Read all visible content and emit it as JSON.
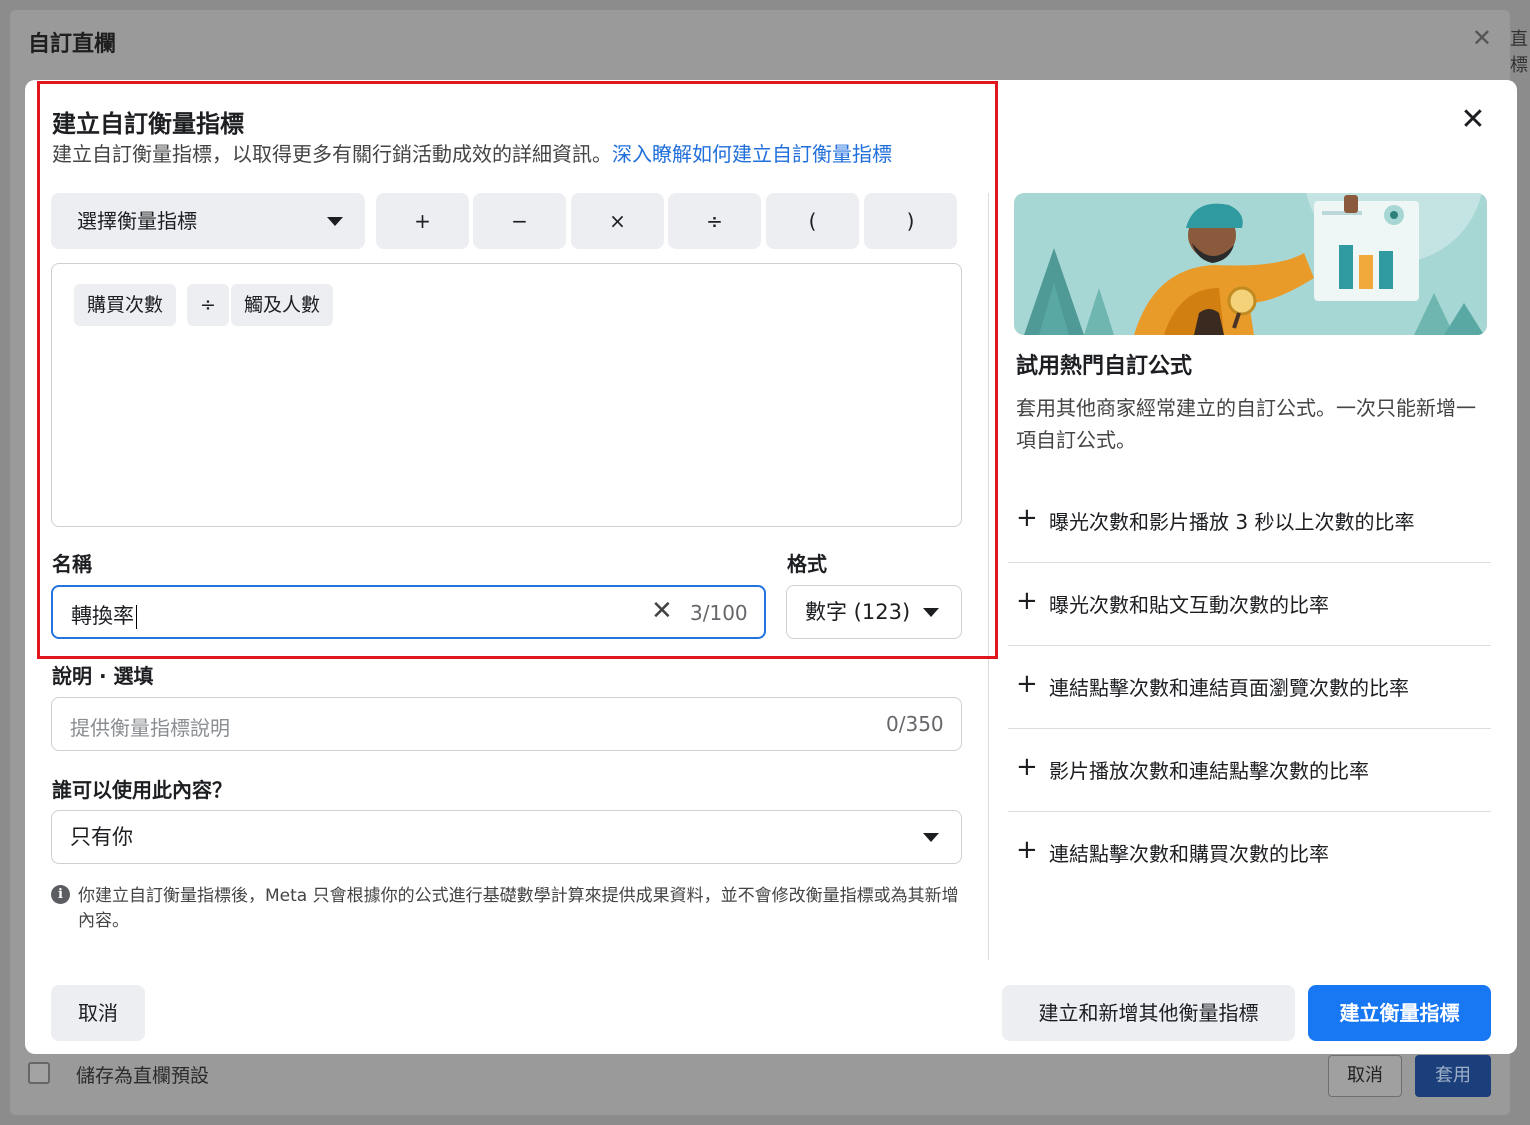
{
  "background": {
    "title": "自訂直欄",
    "edge_text": "直標",
    "save_preset_label": "儲存為直欄預設",
    "cancel_label": "取消",
    "apply_label": "套用"
  },
  "modal": {
    "title": "建立自訂衡量指標",
    "subtitle": "建立自訂衡量指標，以取得更多有關行銷活動成效的詳細資訊。",
    "learn_more_link": "深入瞭解如何建立自訂衡量指標",
    "metric_select_label": "選擇衡量指標",
    "operators": [
      "+",
      "−",
      "×",
      "÷",
      "(",
      ")"
    ],
    "formula_tokens": [
      "購買次數",
      "÷",
      "觸及人數"
    ],
    "name_label": "名稱",
    "name_value": "轉換率",
    "name_count": "3/100",
    "format_label": "格式",
    "format_value": "數字 (123)",
    "description_label": "說明 · 選填",
    "description_placeholder": "提供衡量指標說明",
    "description_count": "0/350",
    "access_label": "誰可以使用此內容？",
    "access_value": "只有你",
    "info_text": "你建立自訂衡量指標後，Meta 只會根據你的公式進行基礎數學計算來提供成果資料，並不會修改衡量指標或為其新增內容。",
    "cancel_label": "取消",
    "create_and_add_label": "建立和新增其他衡量指標",
    "create_label": "建立衡量指標"
  },
  "suggestions_panel": {
    "title": "試用熱門自訂公式",
    "description": "套用其他商家經常建立的自訂公式。一次只能新增一項自訂公式。",
    "items": [
      "曝光次數和影片播放 3 秒以上次數的比率",
      "曝光次數和貼文互動次數的比率",
      "連結點擊次數和連結頁面瀏覽次數的比率",
      "影片播放次數和連結點擊次數的比率",
      "連結點擊次數和購買次數的比率"
    ]
  },
  "colors": {
    "primary": "#1877f2",
    "link": "#216fdb",
    "highlight": "#e0161e",
    "focus_border": "#2374e1"
  }
}
